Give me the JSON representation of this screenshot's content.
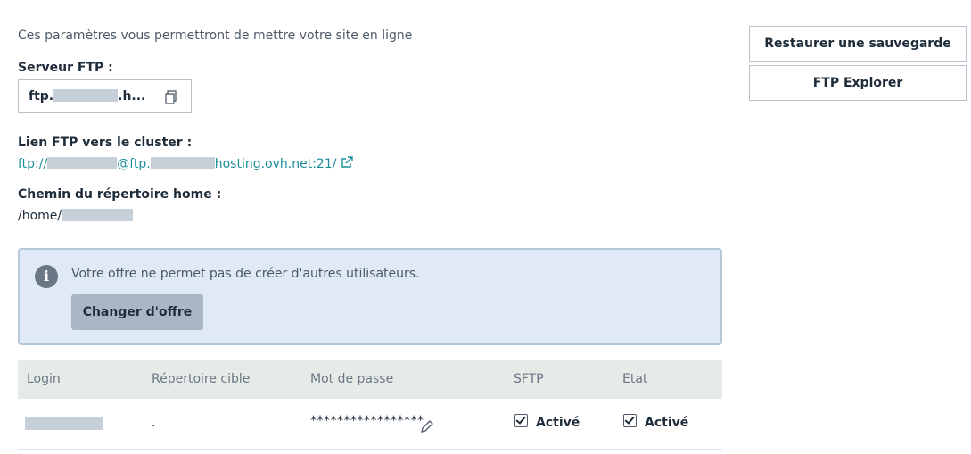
{
  "intro": "Ces paramètres vous permettront de mettre votre site en ligne",
  "ftp_server": {
    "label": "Serveur FTP :",
    "value_prefix": "ftp.",
    "value_suffix": ".h..."
  },
  "ftp_link": {
    "label": "Lien FTP vers le cluster :",
    "part1": "ftp://",
    "part2": "@ftp.",
    "part3": "hosting.ovh.net:21/"
  },
  "home_path": {
    "label": "Chemin du répertoire home :",
    "value_prefix": "/home/"
  },
  "info_box": {
    "message": "Votre offre ne permet pas de créer d'autres utilisateurs.",
    "button": "Changer d'offre",
    "icon": "info-icon"
  },
  "side_buttons": {
    "restore": "Restaurer une sauvegarde",
    "explorer": "FTP Explorer"
  },
  "table": {
    "headers": [
      "Login",
      "Répertoire cible",
      "Mot de passe",
      "SFTP",
      "Etat"
    ],
    "rows": [
      {
        "target": ".",
        "password": "*****************",
        "sftp": "Activé",
        "state": "Activé"
      }
    ]
  },
  "colors": {
    "link": "#1d8f9b",
    "info_bg": "#dfeaf6",
    "button_bg": "#aab6c3",
    "header_bg": "#e6ebe7"
  }
}
